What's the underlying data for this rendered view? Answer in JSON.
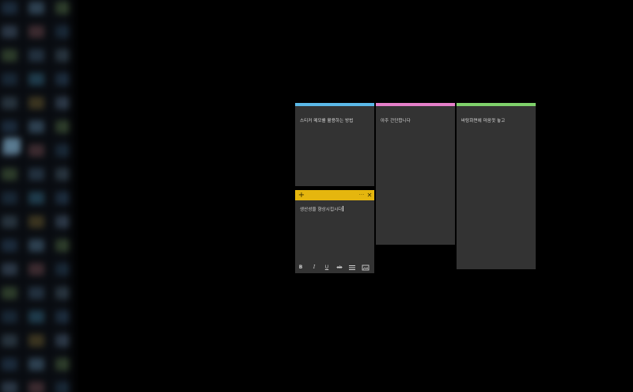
{
  "notes": [
    {
      "text": "스티커 메모를 활용하는 방법",
      "accent": "#5bb9e8"
    },
    {
      "text": "아주 간단합니다",
      "accent": "#e47fc8"
    },
    {
      "text": "바탕화면에 마음껏 놓고",
      "accent": "#7fd16b"
    }
  ],
  "active_note": {
    "text": "생산성을 향상시킵시다",
    "header_color": "#e5b60e",
    "add_icon": "+",
    "more_icon": "···",
    "close_icon": "✕",
    "toolbar": {
      "bold": "B",
      "italic": "I",
      "underline": "U",
      "strikethrough": "ab",
      "bullets_icon": "bullet-list-icon",
      "image_icon": "image-icon"
    }
  },
  "colors": {
    "background": "#000000",
    "note_body": "#333333",
    "note_text": "#d6d6d6"
  }
}
